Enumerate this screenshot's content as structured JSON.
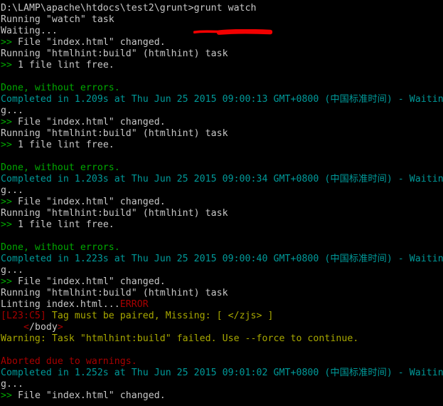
{
  "terminal": {
    "title": "Windows Command Prompt - grunt watch",
    "background_color": "#000000",
    "colors": {
      "white": "#c8c8c8",
      "green": "#00a800",
      "cyan": "#009a9a",
      "red": "#a80000",
      "yellow": "#a8a800",
      "annotation_red": "#f20000"
    },
    "prompt": {
      "path": "D:\\LAMP\\apache\\htdocs\\test2\\grunt",
      "symbol": ">",
      "command": "grunt watch"
    },
    "annotation": {
      "name": "red-highlight-stroke",
      "color": "#f20000"
    },
    "lines": [
      {
        "id": "l01",
        "type": "prompt",
        "segments": [
          {
            "text": "D:\\LAMP\\apache\\htdocs\\test2\\grunt>grunt watch",
            "color": "white"
          }
        ]
      },
      {
        "id": "l02",
        "type": "output",
        "segments": [
          {
            "text": "Running \"watch\" task",
            "color": "white"
          }
        ]
      },
      {
        "id": "l03",
        "type": "output",
        "segments": [
          {
            "text": "Waiting...",
            "color": "white"
          }
        ]
      },
      {
        "id": "l04",
        "type": "output",
        "segments": [
          {
            "text": ">>",
            "color": "green"
          },
          {
            "text": " File \"index.html\" changed.",
            "color": "white"
          }
        ]
      },
      {
        "id": "l05",
        "type": "output",
        "segments": [
          {
            "text": "Running \"htmlhint:build\" (htmlhint) task",
            "color": "white"
          }
        ]
      },
      {
        "id": "l06",
        "type": "output",
        "segments": [
          {
            "text": ">>",
            "color": "green"
          },
          {
            "text": " 1 file lint free.",
            "color": "white"
          }
        ]
      },
      {
        "id": "l07",
        "type": "blank",
        "segments": []
      },
      {
        "id": "l08",
        "type": "output",
        "segments": [
          {
            "text": "Done, without errors.",
            "color": "green"
          }
        ]
      },
      {
        "id": "l09",
        "type": "output",
        "segments": [
          {
            "text": "Completed in 1.209s at Thu Jun 25 2015 09:00:13 GMT+0800 (中国标准时间) - Waitin",
            "color": "cyan"
          }
        ]
      },
      {
        "id": "l10",
        "type": "output",
        "segments": [
          {
            "text": "g...",
            "color": "white"
          }
        ]
      },
      {
        "id": "l11",
        "type": "output",
        "segments": [
          {
            "text": ">>",
            "color": "green"
          },
          {
            "text": " File \"index.html\" changed.",
            "color": "white"
          }
        ]
      },
      {
        "id": "l12",
        "type": "output",
        "segments": [
          {
            "text": "Running \"htmlhint:build\" (htmlhint) task",
            "color": "white"
          }
        ]
      },
      {
        "id": "l13",
        "type": "output",
        "segments": [
          {
            "text": ">>",
            "color": "green"
          },
          {
            "text": " 1 file lint free.",
            "color": "white"
          }
        ]
      },
      {
        "id": "l14",
        "type": "blank",
        "segments": []
      },
      {
        "id": "l15",
        "type": "output",
        "segments": [
          {
            "text": "Done, without errors.",
            "color": "green"
          }
        ]
      },
      {
        "id": "l16",
        "type": "output",
        "segments": [
          {
            "text": "Completed in 1.203s at Thu Jun 25 2015 09:00:34 GMT+0800 (中国标准时间) - Waitin",
            "color": "cyan"
          }
        ]
      },
      {
        "id": "l17",
        "type": "output",
        "segments": [
          {
            "text": "g...",
            "color": "white"
          }
        ]
      },
      {
        "id": "l18",
        "type": "output",
        "segments": [
          {
            "text": ">>",
            "color": "green"
          },
          {
            "text": " File \"index.html\" changed.",
            "color": "white"
          }
        ]
      },
      {
        "id": "l19",
        "type": "output",
        "segments": [
          {
            "text": "Running \"htmlhint:build\" (htmlhint) task",
            "color": "white"
          }
        ]
      },
      {
        "id": "l20",
        "type": "output",
        "segments": [
          {
            "text": ">>",
            "color": "green"
          },
          {
            "text": " 1 file lint free.",
            "color": "white"
          }
        ]
      },
      {
        "id": "l21",
        "type": "blank",
        "segments": []
      },
      {
        "id": "l22",
        "type": "output",
        "segments": [
          {
            "text": "Done, without errors.",
            "color": "green"
          }
        ]
      },
      {
        "id": "l23",
        "type": "output",
        "segments": [
          {
            "text": "Completed in 1.223s at Thu Jun 25 2015 09:00:40 GMT+0800 (中国标准时间) - Waitin",
            "color": "cyan"
          }
        ]
      },
      {
        "id": "l24",
        "type": "output",
        "segments": [
          {
            "text": "g...",
            "color": "white"
          }
        ]
      },
      {
        "id": "l25",
        "type": "output",
        "segments": [
          {
            "text": ">>",
            "color": "green"
          },
          {
            "text": " File \"index.html\" changed.",
            "color": "white"
          }
        ]
      },
      {
        "id": "l26",
        "type": "output",
        "segments": [
          {
            "text": "Running \"htmlhint:build\" (htmlhint) task",
            "color": "white"
          }
        ]
      },
      {
        "id": "l27",
        "type": "output",
        "segments": [
          {
            "text": "Linting index.html...",
            "color": "white"
          },
          {
            "text": "ERROR",
            "color": "red"
          }
        ]
      },
      {
        "id": "l28",
        "type": "output",
        "segments": [
          {
            "text": "[L23:C5]",
            "color": "red"
          },
          {
            "text": " Tag must be paired, Missing: [ </zjs> ]",
            "color": "yellow"
          }
        ]
      },
      {
        "id": "l29",
        "type": "output",
        "segments": [
          {
            "text": "    ",
            "color": "white"
          },
          {
            "text": "<",
            "color": "red"
          },
          {
            "text": "/body",
            "color": "white"
          },
          {
            "text": ">",
            "color": "red"
          }
        ]
      },
      {
        "id": "l30",
        "type": "output",
        "segments": [
          {
            "text": "Warning: Task \"htmlhint:build\" failed. Use --force to continue.",
            "color": "yellow"
          }
        ]
      },
      {
        "id": "l31",
        "type": "blank",
        "segments": []
      },
      {
        "id": "l32",
        "type": "output",
        "segments": [
          {
            "text": "Aborted due to warnings.",
            "color": "red"
          }
        ]
      },
      {
        "id": "l33",
        "type": "output",
        "segments": [
          {
            "text": "Completed in 1.252s at Thu Jun 25 2015 09:01:02 GMT+0800 (中国标准时间) - Waitin",
            "color": "cyan"
          }
        ]
      },
      {
        "id": "l34",
        "type": "output",
        "segments": [
          {
            "text": "g...",
            "color": "white"
          }
        ]
      },
      {
        "id": "l35",
        "type": "output",
        "segments": [
          {
            "text": ">>",
            "color": "green"
          },
          {
            "text": " File \"index.html\" changed.",
            "color": "white"
          }
        ]
      }
    ]
  }
}
